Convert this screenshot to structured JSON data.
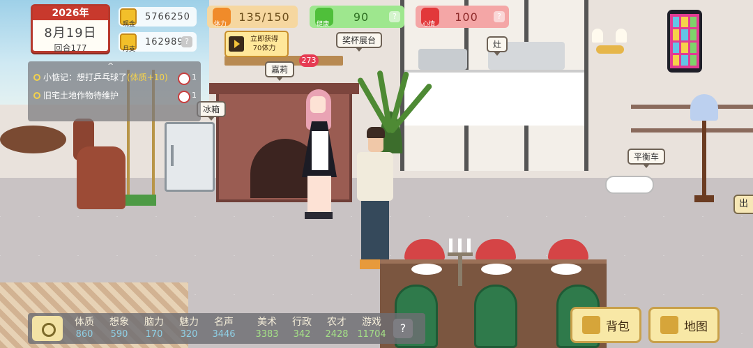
{
  "calendar": {
    "year": "2026年",
    "date": "8月19日",
    "round": "回合177"
  },
  "resources": {
    "cash": {
      "label": "现金",
      "value": "5766250"
    },
    "monthly_expense": {
      "label": "月支",
      "value": "162989",
      "help": "?"
    }
  },
  "stats": {
    "energy": {
      "label": "体力",
      "value": "135/150"
    },
    "health": {
      "label": "健康",
      "value": "90",
      "help": "?"
    },
    "mood": {
      "label": "心情",
      "value": "100",
      "help": "?"
    }
  },
  "ad_offer": {
    "line1": "立即获得",
    "line2": "70体力"
  },
  "badge": "273",
  "tasks": {
    "collapse_icon": "^",
    "items": [
      {
        "text": "小惦记：想打乒乓球了",
        "highlight": "(体质+10)",
        "clock_value": "1"
      },
      {
        "text": "旧宅土地作物待维护",
        "highlight": "",
        "clock_value": "1"
      }
    ]
  },
  "scene_labels": {
    "trophy": "奖杯展台",
    "stove": "灶",
    "character": "嘉莉",
    "fridge": "冰箱",
    "scooter": "平衡车",
    "edge": "出"
  },
  "attributes": [
    {
      "name": "体质",
      "value": "860",
      "group": "a"
    },
    {
      "name": "想象",
      "value": "590",
      "group": "a"
    },
    {
      "name": "脑力",
      "value": "170",
      "group": "a"
    },
    {
      "name": "魅力",
      "value": "320",
      "group": "a"
    },
    {
      "name": "名声",
      "value": "3446",
      "group": "a"
    },
    {
      "name": "美术",
      "value": "3383",
      "group": "b"
    },
    {
      "name": "行政",
      "value": "342",
      "group": "b"
    },
    {
      "name": "农才",
      "value": "2428",
      "group": "b"
    },
    {
      "name": "游戏",
      "value": "11704",
      "group": "b"
    }
  ],
  "bottom_help": "?",
  "buttons": {
    "bag": "背包",
    "map": "地图"
  },
  "colors": {
    "calendar_red": "#c8392d",
    "health_green": "#9ee78e",
    "mood_red": "#f4a6a6",
    "energy_orange": "#f6d7a0"
  }
}
